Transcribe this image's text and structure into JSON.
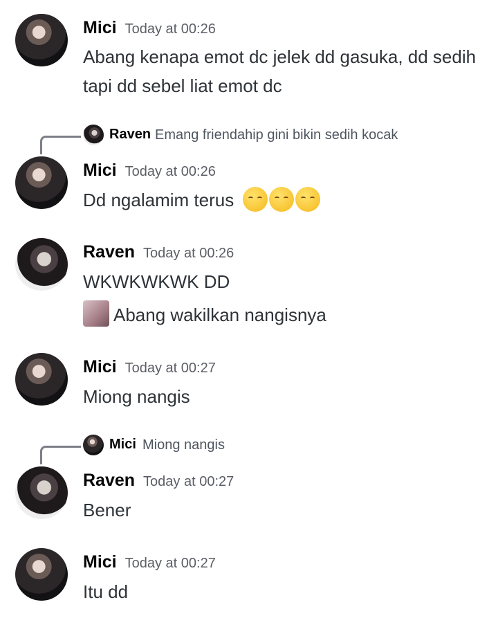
{
  "messages": [
    {
      "author": "Mici",
      "time": "Today at 00:26",
      "text": "Abang kenapa emot dc jelek dd gasuka, dd sedih tapi dd sebel liat emot dc"
    },
    {
      "reply_to": {
        "author": "Raven",
        "text": "Emang friendahip gini bikin sedih kocak"
      },
      "author": "Mici",
      "time": "Today at 00:26",
      "text": "Dd ngalamim terus",
      "emoji": [
        "pensive-emoji",
        "pensive-emoji",
        "pensive-emoji"
      ]
    },
    {
      "author": "Raven",
      "time": "Today at 00:26",
      "text": "WKWKWKWK DD",
      "text2": "Abang wakilkan nangisnya"
    },
    {
      "author": "Mici",
      "time": "Today at 00:27",
      "text": "Miong nangis"
    },
    {
      "reply_to": {
        "author": "Mici",
        "text": "Miong nangis"
      },
      "author": "Raven",
      "time": "Today at 00:27",
      "text": "Bener"
    },
    {
      "author": "Mici",
      "time": "Today at 00:27",
      "text": "Itu dd"
    }
  ]
}
